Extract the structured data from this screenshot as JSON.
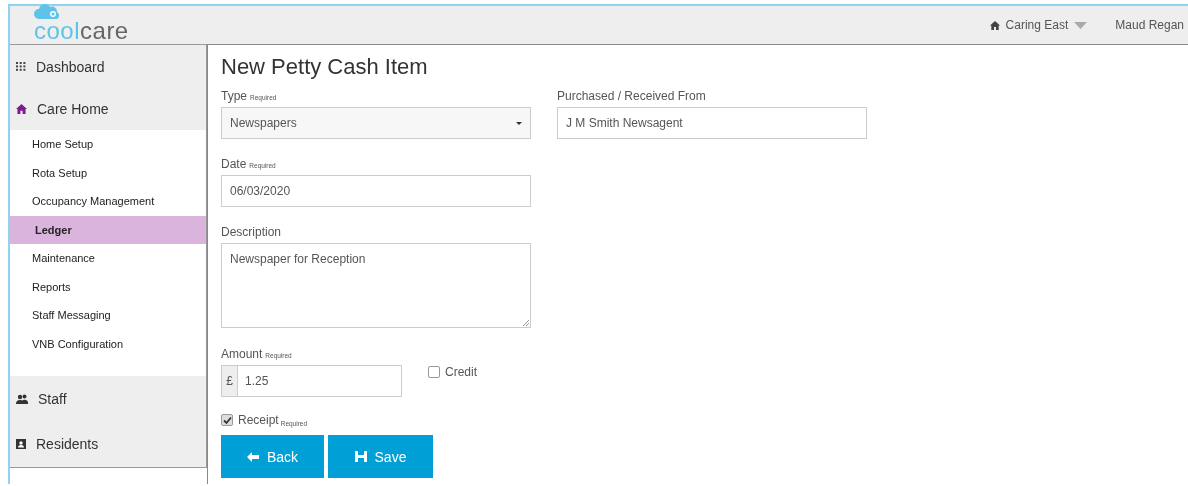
{
  "header": {
    "logo": {
      "part_1": "cool",
      "part_2": "care"
    },
    "location": "Caring East",
    "user": "Maud Regan"
  },
  "sidebar": {
    "items": [
      {
        "label": "Dashboard"
      },
      {
        "label": "Care Home",
        "children": [
          {
            "label": "Home Setup",
            "selected": false
          },
          {
            "label": "Rota Setup",
            "selected": false
          },
          {
            "label": "Occupancy Management",
            "selected": false
          },
          {
            "label": "Ledger",
            "selected": true
          },
          {
            "label": "Maintenance",
            "selected": false
          },
          {
            "label": "Reports",
            "selected": false
          },
          {
            "label": "Staff Messaging",
            "selected": false
          },
          {
            "label": "VNB Configuration",
            "selected": false
          }
        ]
      },
      {
        "label": "Staff"
      },
      {
        "label": "Residents"
      }
    ]
  },
  "form": {
    "title": "New Petty Cash Item",
    "type": {
      "label": "Type",
      "required": "Required",
      "value": "Newspapers"
    },
    "purchased_from": {
      "label": "Purchased / Received From",
      "value": "J M Smith Newsagent"
    },
    "date": {
      "label": "Date",
      "required": "Required",
      "value": "06/03/2020"
    },
    "description": {
      "label": "Description",
      "value": "Newspaper for Reception"
    },
    "amount": {
      "label": "Amount",
      "required": "Required",
      "currency": "£",
      "value": "1.25"
    },
    "credit": {
      "label": "Credit",
      "checked": false
    },
    "receipt": {
      "label": "Receipt",
      "required": "Required",
      "checked": true
    },
    "buttons": [
      {
        "label": "Back",
        "kind": "back"
      },
      {
        "label": "Save",
        "kind": "save"
      }
    ]
  }
}
